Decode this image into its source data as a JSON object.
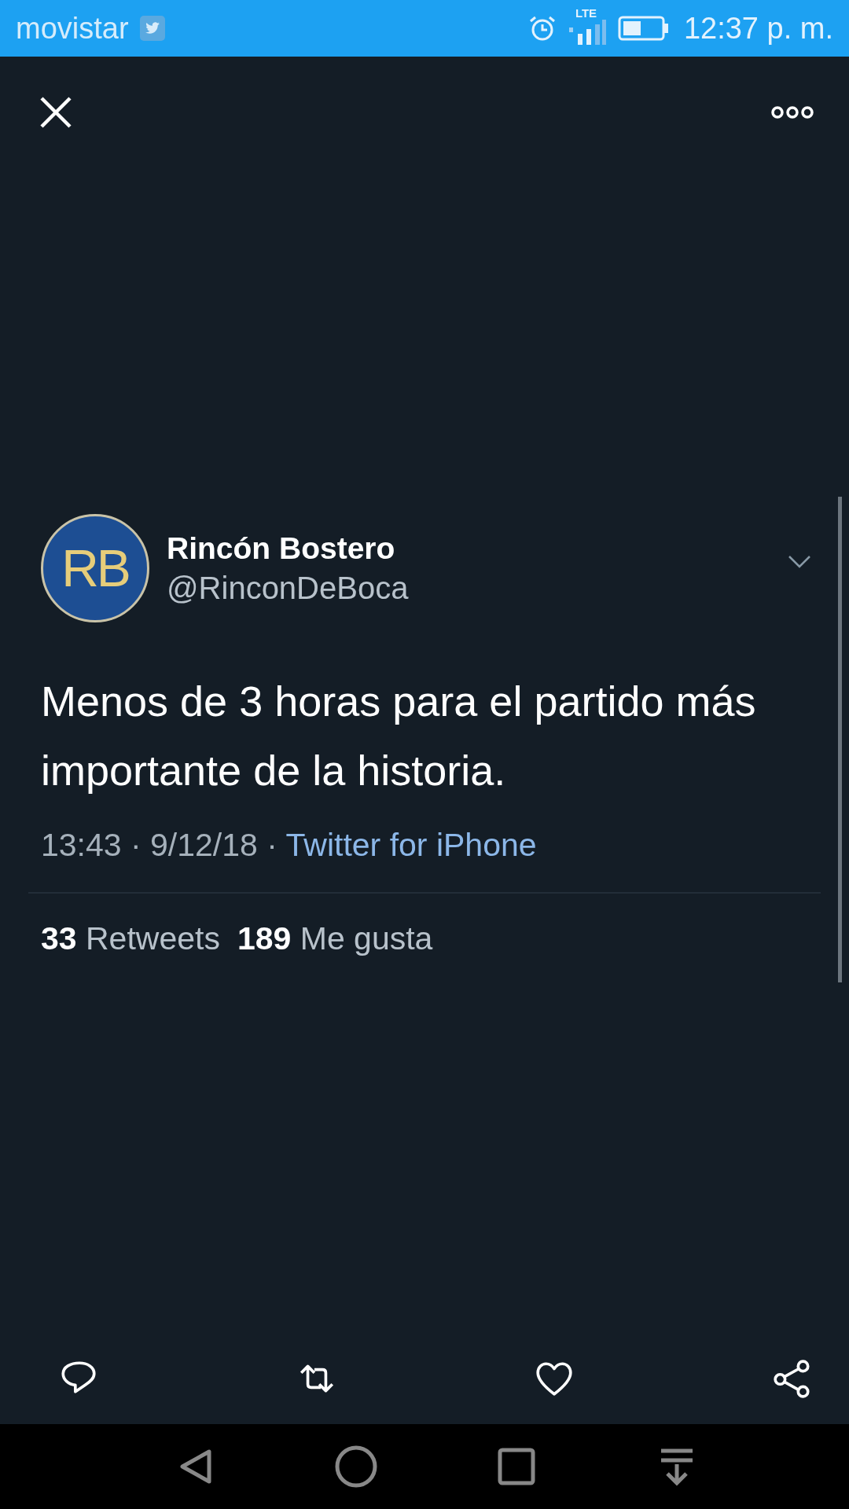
{
  "status_bar": {
    "carrier": "movistar",
    "network": "LTE",
    "time": "12:37 p. m."
  },
  "tweet": {
    "avatar_text": "RB",
    "name": "Rincón Bostero",
    "handle": "@RinconDeBoca",
    "text": "Menos de 3 horas para el partido más importante de la historia.",
    "meta": "13:43 · 9/12/18 · ",
    "source": "Twitter for iPhone",
    "stats": [
      {
        "count": "33",
        "label": "Retweets"
      },
      {
        "count": "189",
        "label": "Me gusta"
      }
    ]
  },
  "actions": [
    {
      "kind": "reply"
    },
    {
      "kind": "retweet"
    },
    {
      "kind": "like"
    },
    {
      "kind": "share"
    }
  ],
  "nav": [
    {
      "kind": "back"
    },
    {
      "kind": "home"
    },
    {
      "kind": "recents"
    },
    {
      "kind": "notifications"
    }
  ]
}
